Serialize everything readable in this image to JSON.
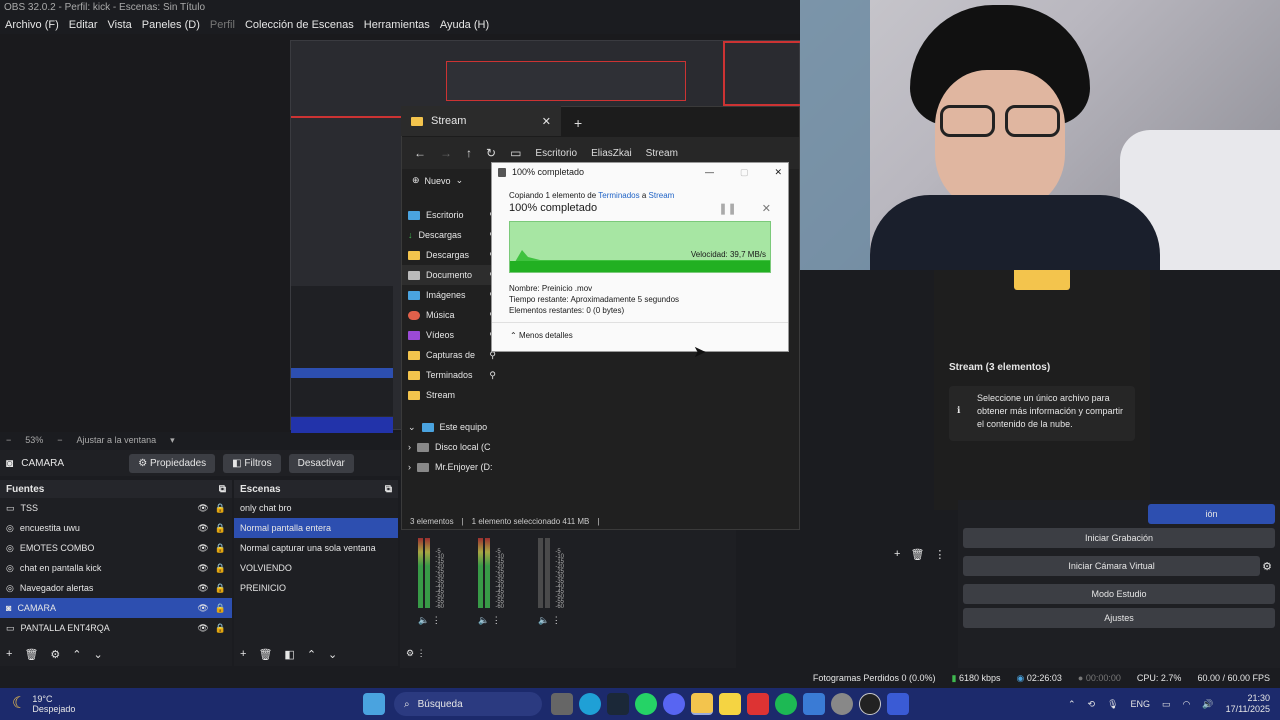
{
  "obs": {
    "title": "OBS 32.0.2 - Perfil: kick - Escenas: Sin Título",
    "menu": [
      "Archivo (F)",
      "Editar",
      "Vista",
      "Paneles (D)",
      "Perfil",
      "Colección de Escenas",
      "Herramientas",
      "Ayuda (H)"
    ],
    "zoom": "53%",
    "fit_label": "Ajustar a la ventana",
    "selected_source": "CAMARA",
    "source_buttons": {
      "properties": "Propiedades",
      "filters": "Filtros",
      "disable": "Desactivar"
    },
    "sources_header": "Fuentes",
    "sources": [
      "TSS",
      "encuestita uwu",
      "EMOTES COMBO",
      "chat en pantalla kick",
      "Navegador alertas",
      "CAMARA",
      "PANTALLA ENT4RQA"
    ],
    "scenes_header": "Escenas",
    "scenes": [
      "only chat bro",
      "Normal pantalla entera",
      "Normal capturar una sola ventana",
      "VOLVIENDO",
      "PREINICIO"
    ],
    "controls": [
      "ión",
      "Iniciar Grabación",
      "Iniciar Cámara Virtual",
      "Modo Estudio",
      "Ajustes"
    ],
    "meter_scale": [
      "-5",
      "-10",
      "-15",
      "-20",
      "-25",
      "-30",
      "-35",
      "-40",
      "-45",
      "-50",
      "-55",
      "-60"
    ],
    "status": {
      "dropped": "Fotogramas Perdidos 0 (0.0%)",
      "bitrate": "6180 kbps",
      "stream_time": "02:26:03",
      "rec_time": "00:00:00",
      "cpu": "CPU: 2.7%",
      "fps": "60.00 / 60.00 FPS"
    }
  },
  "explorer": {
    "tab_title": "Stream",
    "breadcrumb": [
      "Escritorio",
      "EliasZkai",
      "Stream"
    ],
    "new_label": "Nuevo",
    "nav": [
      "Escritorio",
      "Descargas",
      "Descargas",
      "Documento",
      "Imágenes",
      "Música",
      "Vídeos",
      "Capturas de",
      "Terminados",
      "Stream"
    ],
    "this_pc": "Este equipo",
    "drives": [
      "Disco local (C",
      "Mr.Enjoyer (D:"
    ],
    "status": {
      "count": "3 elementos",
      "selected": "1 elemento seleccionado  411 MB"
    },
    "details_title": "Stream (3 elementos)",
    "details_text": "Seleccione un único archivo para obtener más información y compartir el contenido de la nube."
  },
  "dialog": {
    "title": "100% completado",
    "copy_prefix": "Copiando 1 elemento de",
    "from": "Terminados",
    "to_prefix": "a",
    "to": "Stream",
    "heading": "100% completado",
    "speed": "Velocidad: 39,7 MB/s",
    "name": "Nombre: Preinicio .mov",
    "remaining_time": "Tiempo restante:  Aproximadamente 5 segundos",
    "remaining_items": "Elementos restantes:  0 (0 bytes)",
    "less_details": "Menos detalles"
  },
  "taskbar": {
    "weather_temp": "19°C",
    "weather_desc": "Despejado",
    "search": "Búsqueda",
    "lang": "ENG",
    "time": "21:30",
    "date": "17/11/2025"
  }
}
